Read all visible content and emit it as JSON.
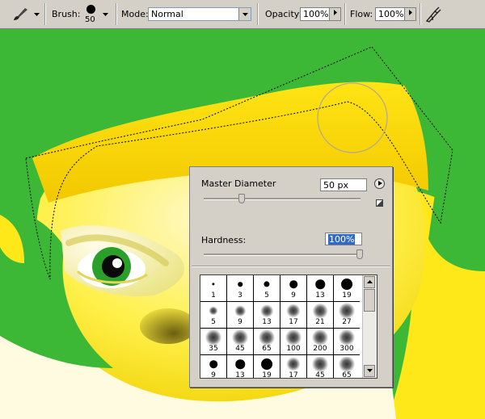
{
  "toolbar": {
    "tool_icon": "brush-tool-icon",
    "brush_label": "Brush:",
    "brush_size": "50",
    "mode_label": "Mode:",
    "mode_value": "Normal",
    "opacity_label": "Opacity:",
    "opacity_value": "100%",
    "flow_label": "Flow:",
    "flow_value": "100%",
    "airbrush_icon": "airbrush-icon"
  },
  "brush_panel": {
    "master_diameter_label": "Master Diameter",
    "master_diameter_value": "50 px",
    "master_diameter_fraction": 0.2,
    "hardness_label": "Hardness:",
    "hardness_value": "100%",
    "hardness_fraction": 1.0,
    "presets": [
      {
        "size": "1",
        "kind": "hard"
      },
      {
        "size": "3",
        "kind": "hard"
      },
      {
        "size": "5",
        "kind": "hard"
      },
      {
        "size": "9",
        "kind": "hard"
      },
      {
        "size": "13",
        "kind": "hard"
      },
      {
        "size": "19",
        "kind": "hard"
      },
      {
        "size": "5",
        "kind": "soft"
      },
      {
        "size": "9",
        "kind": "soft"
      },
      {
        "size": "13",
        "kind": "soft"
      },
      {
        "size": "17",
        "kind": "soft"
      },
      {
        "size": "21",
        "kind": "soft"
      },
      {
        "size": "27",
        "kind": "soft"
      },
      {
        "size": "35",
        "kind": "soft"
      },
      {
        "size": "45",
        "kind": "soft"
      },
      {
        "size": "65",
        "kind": "soft"
      },
      {
        "size": "100",
        "kind": "soft"
      },
      {
        "size": "200",
        "kind": "soft"
      },
      {
        "size": "300",
        "kind": "soft"
      },
      {
        "size": "9",
        "kind": "hard"
      },
      {
        "size": "13",
        "kind": "hard"
      },
      {
        "size": "19",
        "kind": "hard"
      },
      {
        "size": "17",
        "kind": "soft"
      },
      {
        "size": "45",
        "kind": "soft"
      },
      {
        "size": "65",
        "kind": "soft"
      }
    ]
  },
  "colors": {
    "background_green": "#3db836",
    "character_yellow": "#ffe40a",
    "eye_green": "#2aa02a"
  }
}
